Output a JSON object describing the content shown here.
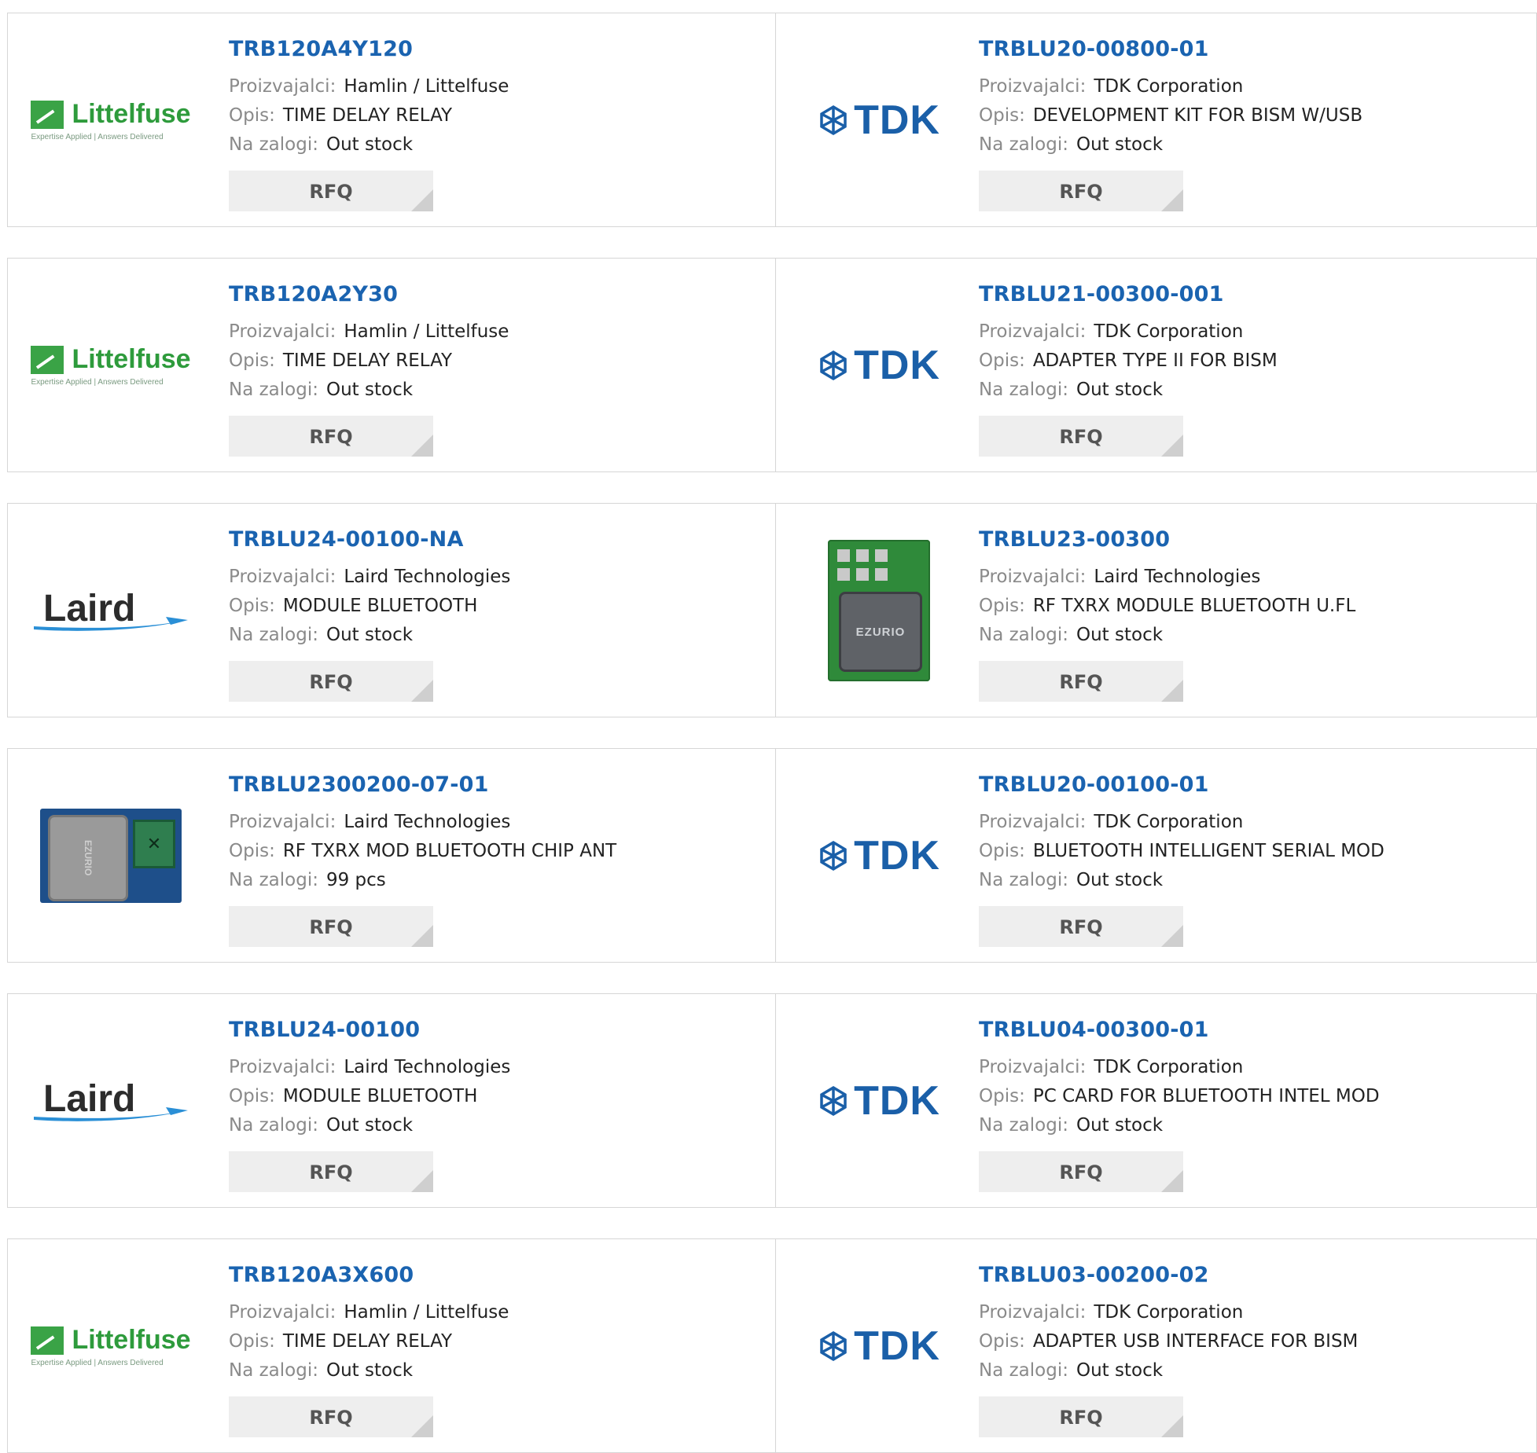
{
  "labels": {
    "manufacturer": "Proizvajalci:",
    "description": "Opis:",
    "stock": "Na zalogi:",
    "rfq": "RFQ"
  },
  "logos": {
    "littelfuse": {
      "word": "Littelfuse",
      "tagline": "Expertise Applied | Answers Delivered"
    },
    "tdk": {
      "word": "TDK"
    },
    "laird": {
      "word": "Laird"
    },
    "ezurio": {
      "text": "EZURIO"
    }
  },
  "colors": {
    "part_link": "#1a63b0",
    "label": "#8a8a8a",
    "rfq_bg": "#eeeeee"
  },
  "rows": [
    {
      "left": {
        "logo": "littelfuse",
        "part": "TRB120A4Y120",
        "manufacturer": "Hamlin / Littelfuse",
        "description": "TIME DELAY RELAY",
        "stock": "Out stock"
      },
      "right": {
        "logo": "tdk",
        "part": "TRBLU20-00800-01",
        "manufacturer": "TDK Corporation",
        "description": "DEVELOPMENT KIT FOR BISM W/USB",
        "stock": "Out stock"
      }
    },
    {
      "left": {
        "logo": "littelfuse",
        "part": "TRB120A2Y30",
        "manufacturer": "Hamlin / Littelfuse",
        "description": "TIME DELAY RELAY",
        "stock": "Out stock"
      },
      "right": {
        "logo": "tdk",
        "part": "TRBLU21-00300-001",
        "manufacturer": "TDK Corporation",
        "description": "ADAPTER TYPE II FOR BISM",
        "stock": "Out stock"
      }
    },
    {
      "left": {
        "logo": "laird",
        "part": "TRBLU24-00100-NA",
        "manufacturer": "Laird Technologies",
        "description": "MODULE BLUETOOTH",
        "stock": "Out stock"
      },
      "right": {
        "logo": "module-green",
        "part": "TRBLU23-00300",
        "manufacturer": "Laird Technologies",
        "description": "RF TXRX MODULE BLUETOOTH U.FL",
        "stock": "Out stock"
      }
    },
    {
      "left": {
        "logo": "module-blue",
        "part": "TRBLU2300200-07-01",
        "manufacturer": "Laird Technologies",
        "description": "RF TXRX MOD BLUETOOTH CHIP ANT",
        "stock": "99 pcs"
      },
      "right": {
        "logo": "tdk",
        "part": "TRBLU20-00100-01",
        "manufacturer": "TDK Corporation",
        "description": "BLUETOOTH INTELLIGENT SERIAL MOD",
        "stock": "Out stock"
      }
    },
    {
      "left": {
        "logo": "laird",
        "part": "TRBLU24-00100",
        "manufacturer": "Laird Technologies",
        "description": "MODULE BLUETOOTH",
        "stock": "Out stock"
      },
      "right": {
        "logo": "tdk",
        "part": "TRBLU04-00300-01",
        "manufacturer": "TDK Corporation",
        "description": "PC CARD FOR BLUETOOTH INTEL MOD",
        "stock": "Out stock"
      }
    },
    {
      "left": {
        "logo": "littelfuse",
        "part": "TRB120A3X600",
        "manufacturer": "Hamlin / Littelfuse",
        "description": "TIME DELAY RELAY",
        "stock": "Out stock"
      },
      "right": {
        "logo": "tdk",
        "part": "TRBLU03-00200-02",
        "manufacturer": "TDK Corporation",
        "description": "ADAPTER USB INTERFACE FOR BISM",
        "stock": "Out stock"
      }
    }
  ]
}
